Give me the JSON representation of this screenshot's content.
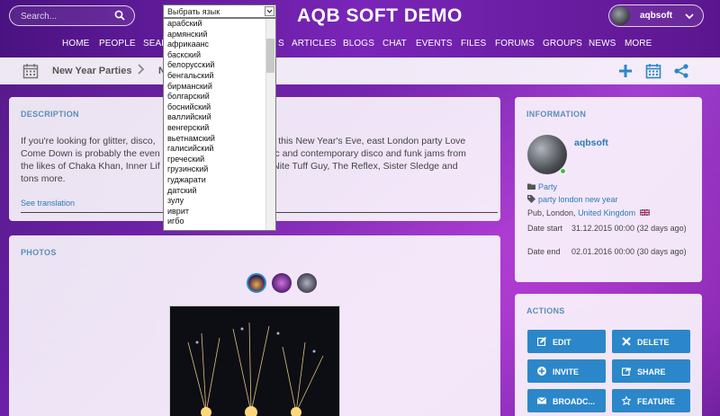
{
  "header": {
    "search_placeholder": "Search...",
    "site_title": "AQB SOFT DEMO",
    "username": "aqbsoft"
  },
  "nav": [
    "HOME",
    "PEOPLE",
    "SEAR",
    "S",
    "ARTICLES",
    "BLOGS",
    "CHAT",
    "EVENTS",
    "FILES",
    "FORUMS",
    "GROUPS",
    "NEWS",
    "MORE"
  ],
  "breadcrumb": {
    "parent": "New Year Parties",
    "current": "N"
  },
  "language_select": {
    "selected": "Выбрать язык",
    "options": [
      "арабский",
      "армянский",
      "африкаанс",
      "баскский",
      "белорусский",
      "бенгальский",
      "бирманский",
      "болгарский",
      "боснийский",
      "валлийский",
      "венгерский",
      "вьетнамский",
      "галисийский",
      "греческий",
      "грузинский",
      "гуджарати",
      "датский",
      "зулу",
      "иврит",
      "игбо"
    ]
  },
  "description": {
    "title": "DESCRIPTION",
    "lines": [
      "If you're looking for glitter, disco,                                          co this New Year's Eve, east London party Love",
      "Come Down is probably the even                                           ic and contemporary disco and funk jams from",
      "the likes of Chaka Khan, Inner Lif                                           Nite Tuff Guy, The Reflex, Sister Sledge and",
      "tons more."
    ],
    "see_translation": "See translation"
  },
  "photos": {
    "title": "PHOTOS"
  },
  "information": {
    "title": "INFORMATION",
    "user": "aqbsoft",
    "category": "Party",
    "tags": "party london new year",
    "location_prefix": "Pub, London, ",
    "location_country": "United Kingdom",
    "date_start_label": "Date start",
    "date_start_value": "31.12.2015 00:00 (32 days ago)",
    "date_end_label": "Date end",
    "date_end_value": "02.01.2016 00:00 (30 days ago)"
  },
  "actions": {
    "title": "ACTIONS",
    "edit": "EDIT",
    "delete": "DELETE",
    "invite": "INVITE",
    "share": "SHARE",
    "broadcast": "BROADC...",
    "feature": "FEATURE"
  },
  "colors": {
    "accent": "#2b87c9",
    "link": "#2b7bb9",
    "title": "#5b8fb5",
    "online": "#3ec13e"
  }
}
